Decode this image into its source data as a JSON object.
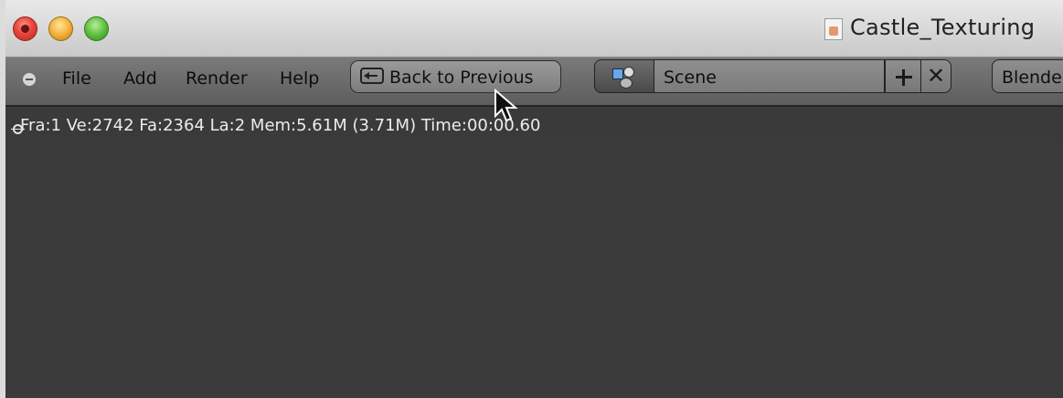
{
  "window": {
    "title": "Castle_Texturing"
  },
  "menu": {
    "items": [
      "File",
      "Add",
      "Render",
      "Help"
    ]
  },
  "toolbar": {
    "back_label": "Back to Previous",
    "scene_name": "Scene",
    "engine": "Blende"
  },
  "info": {
    "stats": "Fra:1  Ve:2742  Fa:2364  La:2  Mem:5.61M (3.71M) Time:00:00.60"
  },
  "icons": [
    "close-icon",
    "minimize-icon",
    "zoom-icon",
    "document-icon",
    "collapse-icon",
    "back-icon",
    "scene-icon",
    "add-icon",
    "delete-icon",
    "info-icon",
    "mouse-cursor-icon"
  ]
}
